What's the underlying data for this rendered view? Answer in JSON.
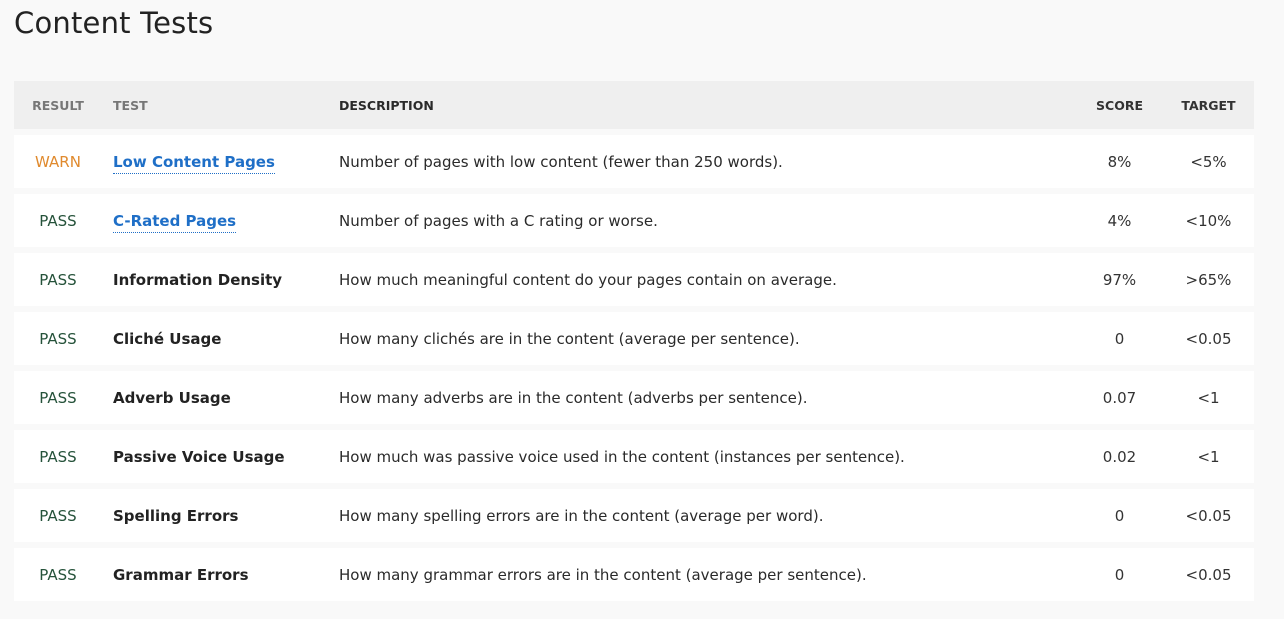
{
  "title": "Content Tests",
  "headers": {
    "result": "RESULT",
    "test": "TEST",
    "description": "DESCRIPTION",
    "score": "SCORE",
    "target": "TARGET"
  },
  "rows": [
    {
      "result": "WARN",
      "test": "Low Content Pages",
      "link": true,
      "description": "Number of pages with low content (fewer than 250 words).",
      "score": "8%",
      "target": "<5%"
    },
    {
      "result": "PASS",
      "test": "C-Rated Pages",
      "link": true,
      "description": "Number of pages with a C rating or worse.",
      "score": "4%",
      "target": "<10%"
    },
    {
      "result": "PASS",
      "test": "Information Density",
      "link": false,
      "description": "How much meaningful content do your pages contain on average.",
      "score": "97%",
      "target": ">65%"
    },
    {
      "result": "PASS",
      "test": "Cliché Usage",
      "link": false,
      "description": "How many clichés are in the content (average per sentence).",
      "score": "0",
      "target": "<0.05"
    },
    {
      "result": "PASS",
      "test": "Adverb Usage",
      "link": false,
      "description": "How many adverbs are in the content (adverbs per sentence).",
      "score": "0.07",
      "target": "<1"
    },
    {
      "result": "PASS",
      "test": "Passive Voice Usage",
      "link": false,
      "description": "How much was passive voice used in the content (instances per sentence).",
      "score": "0.02",
      "target": "<1"
    },
    {
      "result": "PASS",
      "test": "Spelling Errors",
      "link": false,
      "description": "How many spelling errors are in the content (average per word).",
      "score": "0",
      "target": "<0.05"
    },
    {
      "result": "PASS",
      "test": "Grammar Errors",
      "link": false,
      "description": "How many grammar errors are in the content (average per sentence).",
      "score": "0",
      "target": "<0.05"
    }
  ],
  "colors": {
    "pass": "#25523a",
    "warn": "#e08a2e",
    "link": "#1f6fc7"
  }
}
